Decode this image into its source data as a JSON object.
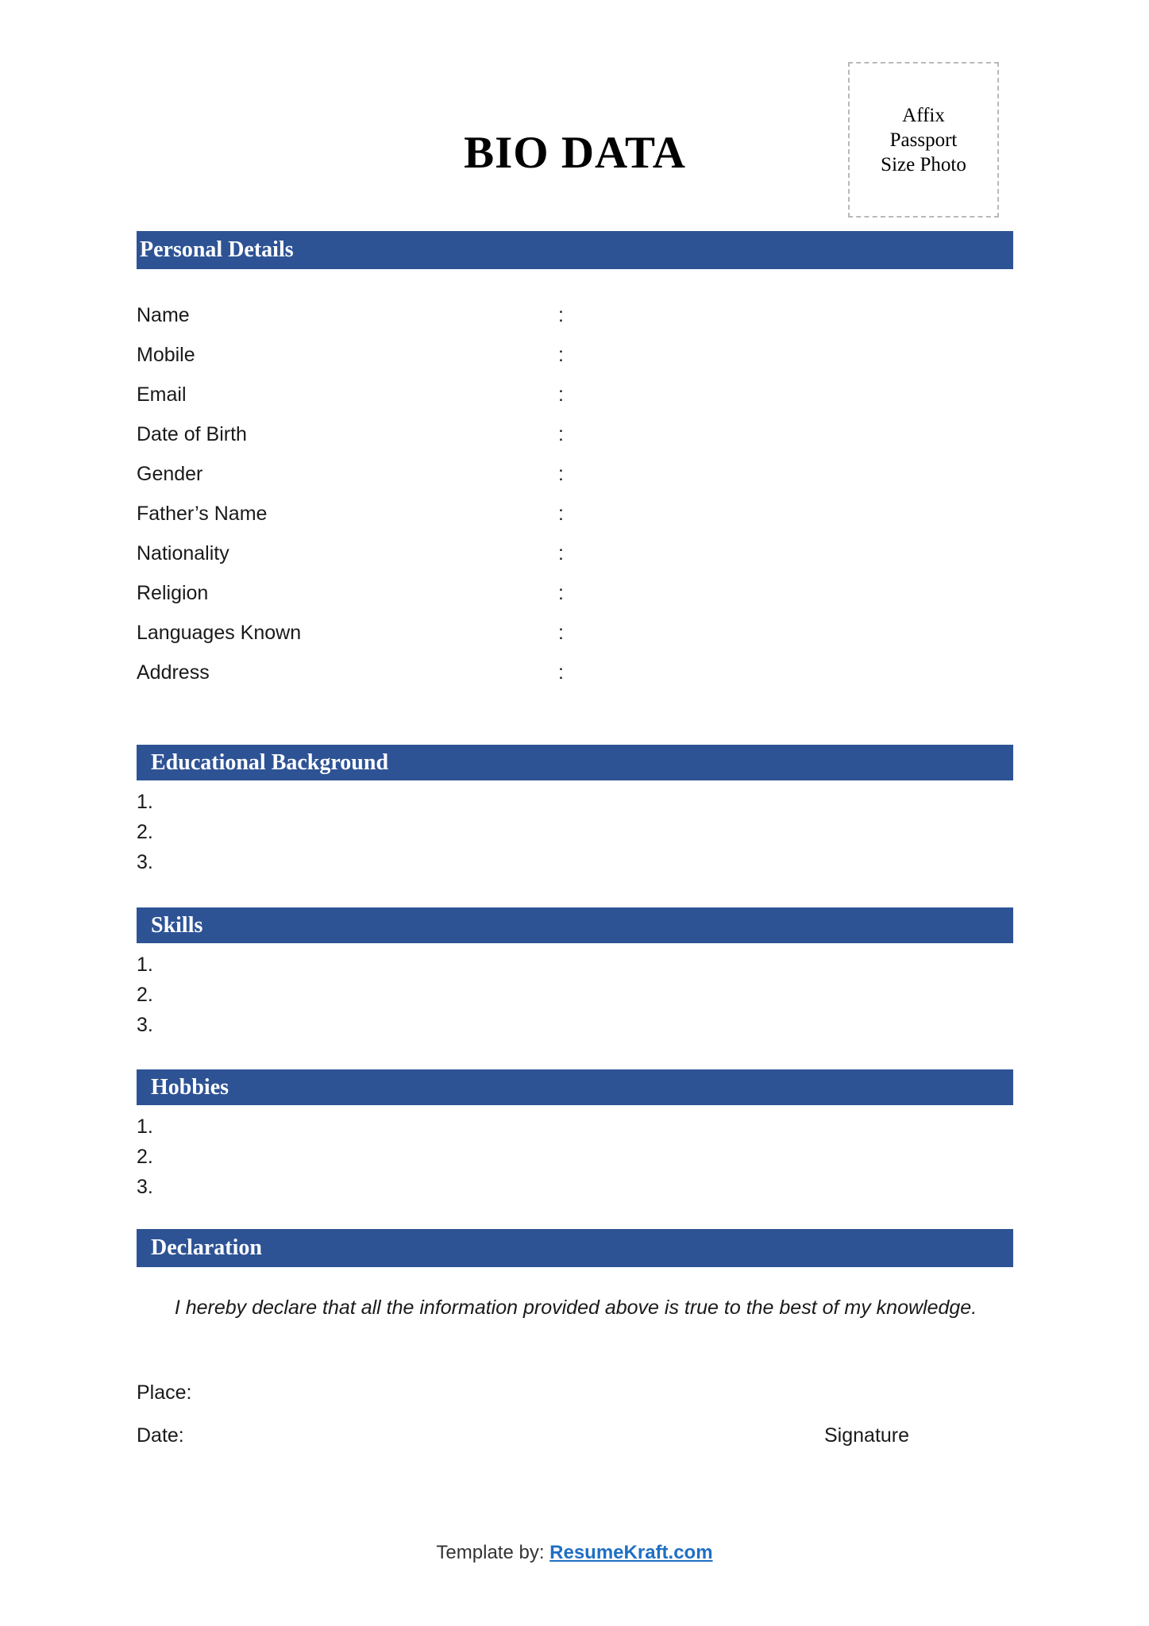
{
  "document": {
    "title": "BIO DATA"
  },
  "photo_box": {
    "lines": [
      "Affix",
      "Passport",
      "Size Photo"
    ],
    "border_style": "dashed",
    "border_color": "#b9b9b9"
  },
  "theme": {
    "bar_color": "#2e5395",
    "bar_text_color": "#ffffff",
    "body_text_color": "#1a1a1a",
    "link_color": "#1f6fc4",
    "page_background": "#ffffff"
  },
  "sections": {
    "personal_details": {
      "heading": "Personal Details",
      "separator": ":",
      "fields": [
        {
          "label": "Name",
          "value": ""
        },
        {
          "label": "Mobile",
          "value": ""
        },
        {
          "label": "Email",
          "value": ""
        },
        {
          "label": "Date of Birth",
          "value": ""
        },
        {
          "label": "Gender",
          "value": ""
        },
        {
          "label": "Father’s Name",
          "value": ""
        },
        {
          "label": "Nationality",
          "value": ""
        },
        {
          "label": "Religion",
          "value": ""
        },
        {
          "label": "Languages Known",
          "value": ""
        },
        {
          "label": "Address",
          "value": ""
        }
      ]
    },
    "educational_background": {
      "heading": "Educational Background",
      "items": [
        {
          "number": "1.",
          "text": ""
        },
        {
          "number": "2.",
          "text": ""
        },
        {
          "number": "3.",
          "text": ""
        }
      ]
    },
    "skills": {
      "heading": "Skills",
      "items": [
        {
          "number": "1.",
          "text": ""
        },
        {
          "number": "2.",
          "text": ""
        },
        {
          "number": "3.",
          "text": ""
        }
      ]
    },
    "hobbies": {
      "heading": "Hobbies",
      "items": [
        {
          "number": "1.",
          "text": ""
        },
        {
          "number": "2.",
          "text": ""
        },
        {
          "number": "3.",
          "text": ""
        }
      ]
    },
    "declaration": {
      "heading": "Declaration",
      "statement": "I hereby declare that all the information provided above is true to the best of my knowledge.",
      "place_label": "Place:",
      "date_label": "Date:",
      "signature_label": "Signature"
    }
  },
  "footer": {
    "prefix": "Template by: ",
    "brand": "ResumeKraft.com"
  }
}
